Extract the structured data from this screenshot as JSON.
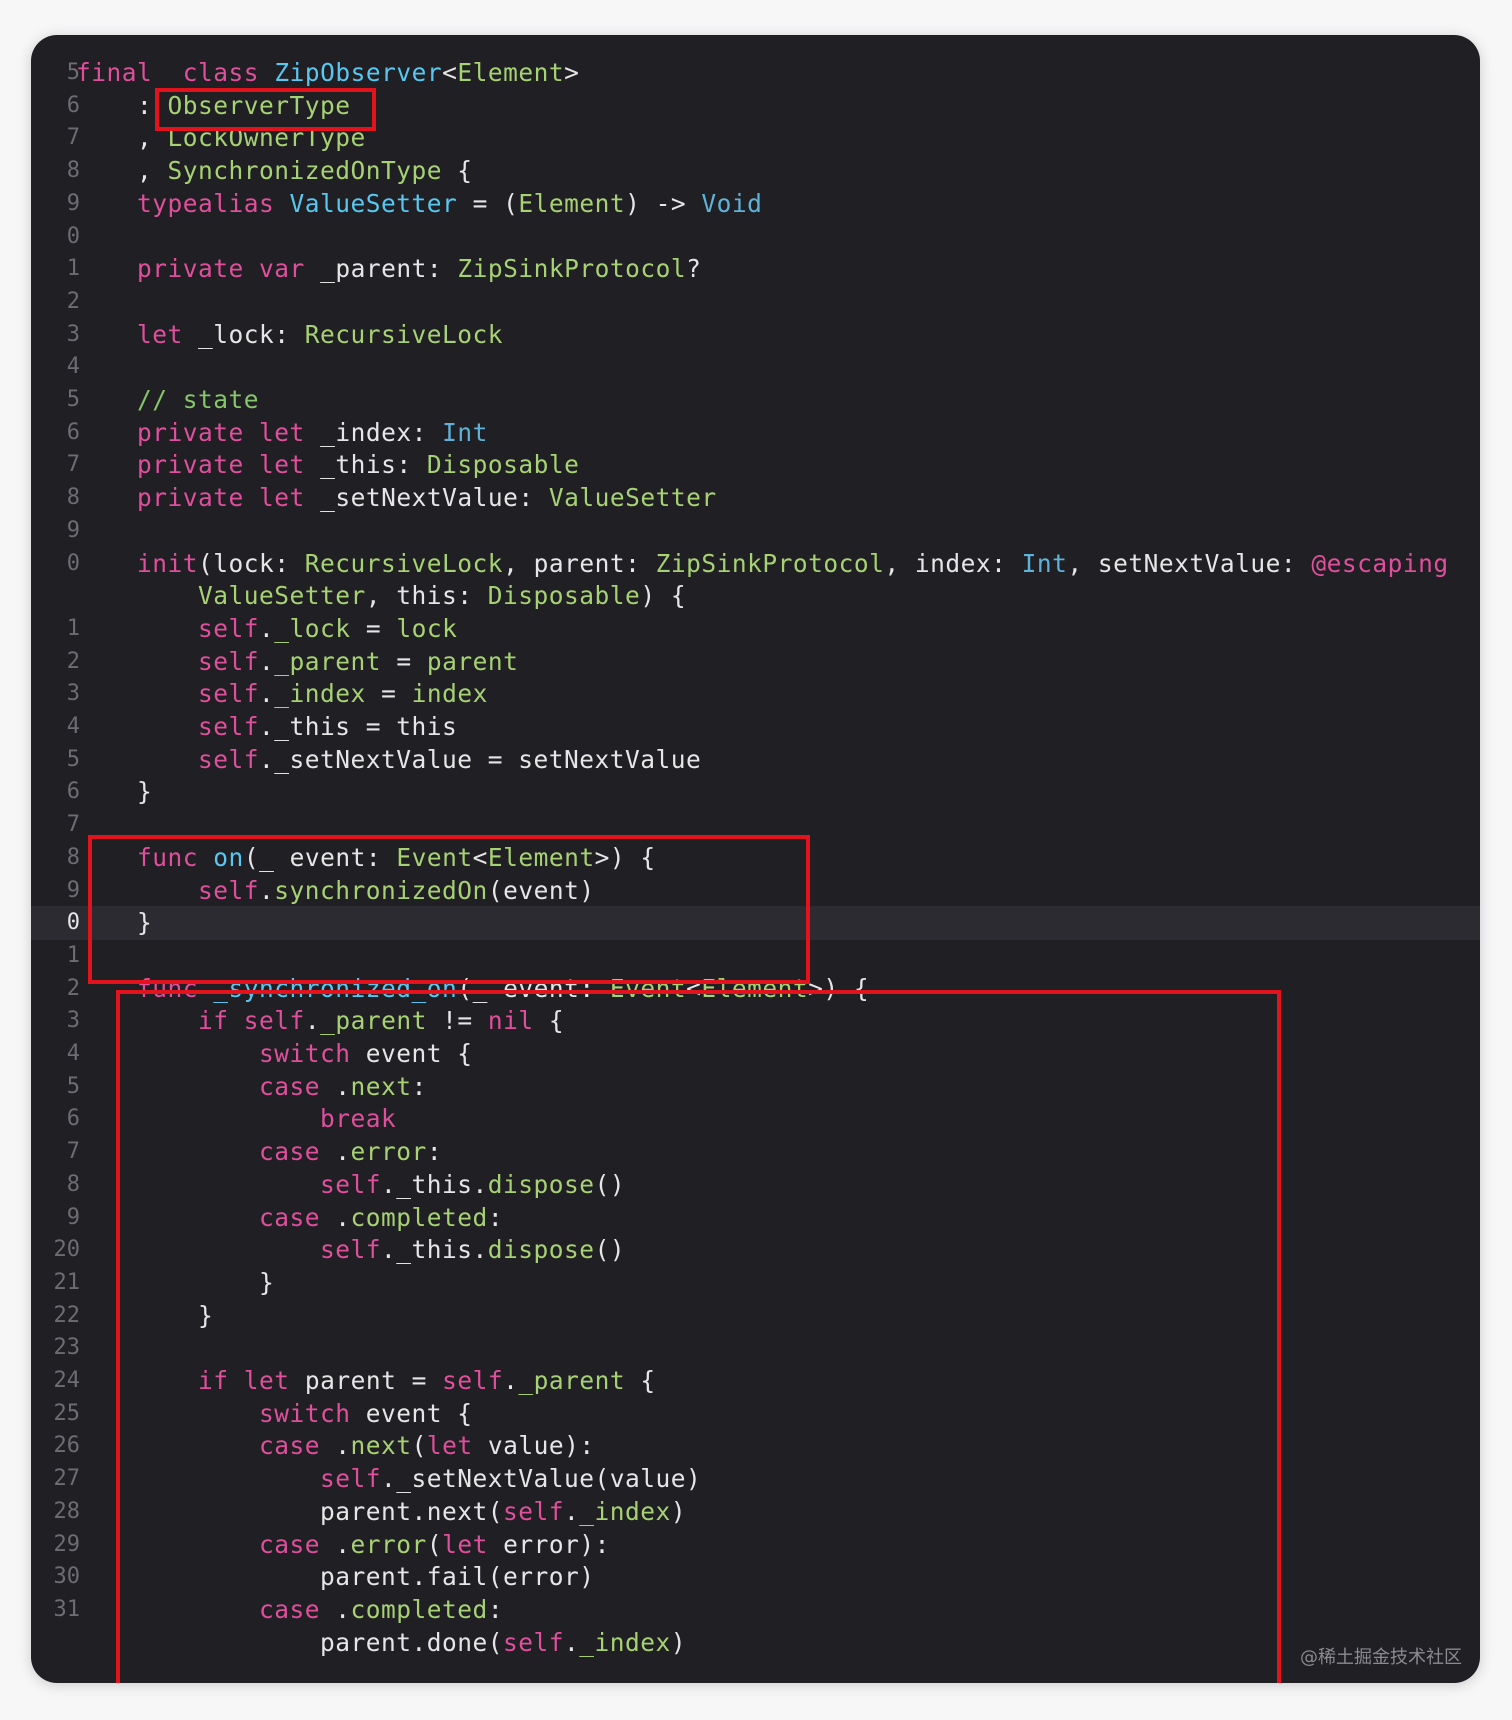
{
  "editor": {
    "theme_colors": {
      "background": "#1f1f24",
      "keyword": "#e04f9c",
      "type": "#a7d273",
      "declaration": "#59c7ef",
      "comment": "#86c56a",
      "highlight_box": "#e2131d"
    },
    "current_line_number": "0",
    "lines": [
      {
        "n": "5",
        "tokens": [
          [
            "kw",
            "final"
          ],
          [
            "",
            "  "
          ],
          [
            "kw",
            "class"
          ],
          [
            "",
            " "
          ],
          [
            "decl",
            "ZipObserver"
          ],
          [
            "",
            "<"
          ],
          [
            "typ",
            "Element"
          ],
          [
            "",
            ">"
          ]
        ]
      },
      {
        "n": "6",
        "tokens": [
          [
            "",
            "    : "
          ],
          [
            "typ",
            "ObserverType"
          ]
        ]
      },
      {
        "n": "7",
        "tokens": [
          [
            "",
            "    , "
          ],
          [
            "typ",
            "LockOwnerType"
          ]
        ]
      },
      {
        "n": "8",
        "tokens": [
          [
            "",
            "    , "
          ],
          [
            "typ",
            "SynchronizedOnType"
          ],
          [
            "",
            " {"
          ]
        ]
      },
      {
        "n": "9",
        "tokens": [
          [
            "",
            "    "
          ],
          [
            "kw",
            "typealias"
          ],
          [
            "",
            " "
          ],
          [
            "decl",
            "ValueSetter"
          ],
          [
            "",
            " = ("
          ],
          [
            "typ",
            "Element"
          ],
          [
            "",
            ") -> "
          ],
          [
            "sys",
            "Void"
          ]
        ]
      },
      {
        "n": "0",
        "tokens": []
      },
      {
        "n": "1",
        "tokens": [
          [
            "",
            "    "
          ],
          [
            "kw",
            "private"
          ],
          [
            "",
            " "
          ],
          [
            "kw",
            "var"
          ],
          [
            "",
            " _parent: "
          ],
          [
            "typ",
            "ZipSinkProtocol"
          ],
          [
            "",
            "?"
          ]
        ]
      },
      {
        "n": "2",
        "tokens": []
      },
      {
        "n": "3",
        "tokens": [
          [
            "",
            "    "
          ],
          [
            "kw",
            "let"
          ],
          [
            "",
            " _lock: "
          ],
          [
            "typ",
            "RecursiveLock"
          ]
        ]
      },
      {
        "n": "4",
        "tokens": []
      },
      {
        "n": "5",
        "tokens": [
          [
            "",
            "    "
          ],
          [
            "cmt",
            "// state"
          ]
        ]
      },
      {
        "n": "6",
        "tokens": [
          [
            "",
            "    "
          ],
          [
            "kw",
            "private"
          ],
          [
            "",
            " "
          ],
          [
            "kw",
            "let"
          ],
          [
            "",
            " _index: "
          ],
          [
            "sys",
            "Int"
          ]
        ]
      },
      {
        "n": "7",
        "tokens": [
          [
            "",
            "    "
          ],
          [
            "kw",
            "private"
          ],
          [
            "",
            " "
          ],
          [
            "kw",
            "let"
          ],
          [
            "",
            " _this: "
          ],
          [
            "typ",
            "Disposable"
          ]
        ]
      },
      {
        "n": "8",
        "tokens": [
          [
            "",
            "    "
          ],
          [
            "kw",
            "private"
          ],
          [
            "",
            " "
          ],
          [
            "kw",
            "let"
          ],
          [
            "",
            " _setNextValue: "
          ],
          [
            "typ",
            "ValueSetter"
          ]
        ]
      },
      {
        "n": "9",
        "tokens": []
      },
      {
        "n": "0",
        "tokens": [
          [
            "",
            "    "
          ],
          [
            "kw",
            "init"
          ],
          [
            "",
            "(lock: "
          ],
          [
            "typ",
            "RecursiveLock"
          ],
          [
            "",
            ", parent: "
          ],
          [
            "typ",
            "ZipSinkProtocol"
          ],
          [
            "",
            ", index: "
          ],
          [
            "sys",
            "Int"
          ],
          [
            "",
            ", setNextValue: "
          ],
          [
            "kw",
            "@escaping"
          ]
        ]
      },
      {
        "n": "",
        "tokens": [
          [
            "",
            "        "
          ],
          [
            "typ",
            "ValueSetter"
          ],
          [
            "",
            ", this: "
          ],
          [
            "typ",
            "Disposable"
          ],
          [
            "",
            ") {"
          ]
        ]
      },
      {
        "n": "1",
        "tokens": [
          [
            "",
            "        "
          ],
          [
            "kw",
            "self"
          ],
          [
            "",
            "."
          ],
          [
            "mem",
            "_lock"
          ],
          [
            "",
            " = "
          ],
          [
            "mem",
            "lock"
          ]
        ]
      },
      {
        "n": "2",
        "tokens": [
          [
            "",
            "        "
          ],
          [
            "kw",
            "self"
          ],
          [
            "",
            "."
          ],
          [
            "mem",
            "_parent"
          ],
          [
            "",
            " = "
          ],
          [
            "mem",
            "parent"
          ]
        ]
      },
      {
        "n": "3",
        "tokens": [
          [
            "",
            "        "
          ],
          [
            "kw",
            "self"
          ],
          [
            "",
            "."
          ],
          [
            "mem",
            "_index"
          ],
          [
            "",
            " = "
          ],
          [
            "mem",
            "index"
          ]
        ]
      },
      {
        "n": "4",
        "tokens": [
          [
            "",
            "        "
          ],
          [
            "kw",
            "self"
          ],
          [
            "",
            "._this = this"
          ]
        ]
      },
      {
        "n": "5",
        "tokens": [
          [
            "",
            "        "
          ],
          [
            "kw",
            "self"
          ],
          [
            "",
            "._setNextValue = setNextValue"
          ]
        ]
      },
      {
        "n": "6",
        "tokens": [
          [
            "",
            "    }"
          ]
        ]
      },
      {
        "n": "7",
        "tokens": []
      },
      {
        "n": "8",
        "tokens": [
          [
            "",
            "    "
          ],
          [
            "kw",
            "func"
          ],
          [
            "",
            " "
          ],
          [
            "decl",
            "on"
          ],
          [
            "",
            "(_ event: "
          ],
          [
            "typ",
            "Event"
          ],
          [
            "",
            "<"
          ],
          [
            "typ",
            "Element"
          ],
          [
            "",
            ">) {"
          ]
        ]
      },
      {
        "n": "9",
        "tokens": [
          [
            "",
            "        "
          ],
          [
            "kw",
            "self"
          ],
          [
            "",
            "."
          ],
          [
            "mem",
            "synchronizedOn"
          ],
          [
            "",
            "(event)"
          ]
        ]
      },
      {
        "n": "0",
        "tokens": [
          [
            "",
            "    }"
          ]
        ]
      },
      {
        "n": "1",
        "tokens": []
      },
      {
        "n": "2",
        "tokens": [
          [
            "",
            "    "
          ],
          [
            "kw",
            "func"
          ],
          [
            "",
            " "
          ],
          [
            "decl",
            "_synchronized_on"
          ],
          [
            "",
            "(_ event: "
          ],
          [
            "typ",
            "Event"
          ],
          [
            "",
            "<"
          ],
          [
            "typ",
            "Element"
          ],
          [
            "",
            ">) {"
          ]
        ]
      },
      {
        "n": "3",
        "tokens": [
          [
            "",
            "        "
          ],
          [
            "kw",
            "if"
          ],
          [
            "",
            " "
          ],
          [
            "kw",
            "self"
          ],
          [
            "",
            "."
          ],
          [
            "mem",
            "_parent"
          ],
          [
            "",
            " != "
          ],
          [
            "kw",
            "nil"
          ],
          [
            "",
            " {"
          ]
        ]
      },
      {
        "n": "4",
        "tokens": [
          [
            "",
            "            "
          ],
          [
            "kw",
            "switch"
          ],
          [
            "",
            " event {"
          ]
        ]
      },
      {
        "n": "5",
        "tokens": [
          [
            "",
            "            "
          ],
          [
            "kw",
            "case"
          ],
          [
            "",
            " ."
          ],
          [
            "mem",
            "next"
          ],
          [
            "",
            ":"
          ]
        ]
      },
      {
        "n": "6",
        "tokens": [
          [
            "",
            "                "
          ],
          [
            "kw",
            "break"
          ]
        ]
      },
      {
        "n": "7",
        "tokens": [
          [
            "",
            "            "
          ],
          [
            "kw",
            "case"
          ],
          [
            "",
            " ."
          ],
          [
            "mem",
            "error"
          ],
          [
            "",
            ":"
          ]
        ]
      },
      {
        "n": "8",
        "tokens": [
          [
            "",
            "                "
          ],
          [
            "kw",
            "self"
          ],
          [
            "",
            "._this."
          ],
          [
            "mem",
            "dispose"
          ],
          [
            "",
            "()"
          ]
        ]
      },
      {
        "n": "9",
        "tokens": [
          [
            "",
            "            "
          ],
          [
            "kw",
            "case"
          ],
          [
            "",
            " ."
          ],
          [
            "mem",
            "completed"
          ],
          [
            "",
            ":"
          ]
        ]
      },
      {
        "n": "20",
        "tokens": [
          [
            "",
            "                "
          ],
          [
            "kw",
            "self"
          ],
          [
            "",
            "._this."
          ],
          [
            "mem",
            "dispose"
          ],
          [
            "",
            "()"
          ]
        ]
      },
      {
        "n": "21",
        "tokens": [
          [
            "",
            "            }"
          ]
        ]
      },
      {
        "n": "22",
        "tokens": [
          [
            "",
            "        }"
          ]
        ]
      },
      {
        "n": "23",
        "tokens": []
      },
      {
        "n": "24",
        "tokens": [
          [
            "",
            "        "
          ],
          [
            "kw",
            "if"
          ],
          [
            "",
            " "
          ],
          [
            "kw",
            "let"
          ],
          [
            "",
            " parent = "
          ],
          [
            "kw",
            "self"
          ],
          [
            "",
            "."
          ],
          [
            "mem",
            "_parent"
          ],
          [
            "",
            " {"
          ]
        ]
      },
      {
        "n": "25",
        "tokens": [
          [
            "",
            "            "
          ],
          [
            "kw",
            "switch"
          ],
          [
            "",
            " event {"
          ]
        ]
      },
      {
        "n": "26",
        "tokens": [
          [
            "",
            "            "
          ],
          [
            "kw",
            "case"
          ],
          [
            "",
            " ."
          ],
          [
            "mem",
            "next"
          ],
          [
            "",
            "("
          ],
          [
            "kw",
            "let"
          ],
          [
            "",
            " value):"
          ]
        ]
      },
      {
        "n": "27",
        "tokens": [
          [
            "",
            "                "
          ],
          [
            "kw",
            "self"
          ],
          [
            "",
            "._setNextValue(value)"
          ]
        ]
      },
      {
        "n": "28",
        "tokens": [
          [
            "",
            "                parent.next("
          ],
          [
            "kw",
            "self"
          ],
          [
            "",
            "."
          ],
          [
            "mem",
            "_index"
          ],
          [
            "",
            ")"
          ]
        ]
      },
      {
        "n": "29",
        "tokens": [
          [
            "",
            "            "
          ],
          [
            "kw",
            "case"
          ],
          [
            "",
            " ."
          ],
          [
            "mem",
            "error"
          ],
          [
            "",
            "("
          ],
          [
            "kw",
            "let"
          ],
          [
            "",
            " error):"
          ]
        ]
      },
      {
        "n": "30",
        "tokens": [
          [
            "",
            "                parent.fail(error)"
          ]
        ]
      },
      {
        "n": "31",
        "tokens": [
          [
            "",
            "            "
          ],
          [
            "kw",
            "case"
          ],
          [
            "",
            " ."
          ],
          [
            "mem",
            "completed"
          ],
          [
            "",
            ":"
          ]
        ]
      },
      {
        "n": "",
        "tokens": [
          [
            "",
            "                parent.done("
          ],
          [
            "kw",
            "self"
          ],
          [
            "",
            "."
          ],
          [
            "mem",
            "_index"
          ],
          [
            "",
            ")"
          ]
        ]
      }
    ]
  },
  "watermark": "@稀土掘金技术社区"
}
